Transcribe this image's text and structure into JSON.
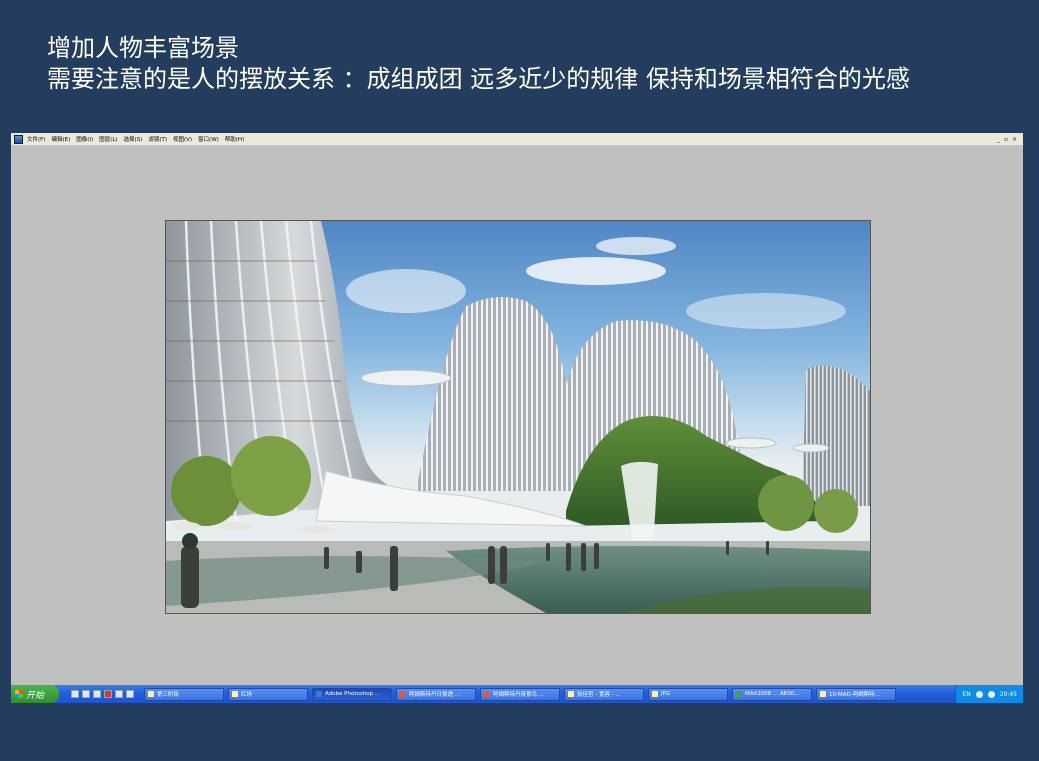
{
  "slide": {
    "title_line1": "增加人物丰富场景",
    "title_line2": "需要注意的是人的摆放关系 ：成组成团 远多近少的规律 保持和场景相符合的光感"
  },
  "menubar": {
    "items": [
      "文件(F)",
      "编辑(E)",
      "图像(I)",
      "图层(L)",
      "选择(S)",
      "滤镜(T)",
      "视图(V)",
      "窗口(W)",
      "帮助(H)"
    ],
    "controls": [
      "_",
      "▫",
      "×"
    ]
  },
  "taskbar": {
    "start_label": "开始",
    "tasks": [
      {
        "label": "第三阶段",
        "active": false
      },
      {
        "label": "红场",
        "active": false
      },
      {
        "label": "Adobe Photoshop ...",
        "active": true
      },
      {
        "label": "阿姆斯特丹日景透 ...",
        "active": false
      },
      {
        "label": "阿姆斯特丹夜景鸟 ...",
        "active": false
      },
      {
        "label": "张佳哲 - 宽容 - ...",
        "active": false
      },
      {
        "label": "JPG",
        "active": false
      },
      {
        "label": "MAX2008 ... AE00...",
        "active": false
      },
      {
        "label": "10-MAD-阿姆斯特...",
        "active": false
      }
    ],
    "tray_lang": "EN",
    "clock": "20:45"
  },
  "colors": {
    "slide_bg": "#243d5e",
    "workspace_gray": "#c0c0c0",
    "taskbar_blue": "#245edb"
  }
}
